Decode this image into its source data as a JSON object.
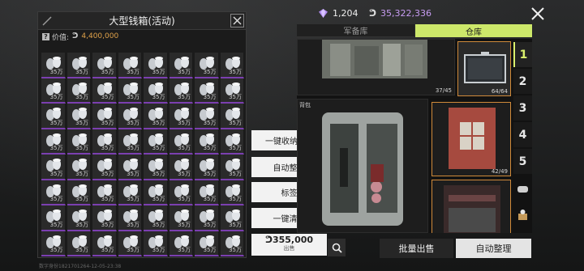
{
  "currency": {
    "gems": "1,204",
    "coins": "35,322,336",
    "gem_color": "#b18bf0",
    "coin_color": "#c79cf2"
  },
  "box_panel": {
    "title": "大型钱箱(活动)",
    "value_label": "价值:",
    "value_amount": "4,400,000",
    "item_label": "35万",
    "rows": 8,
    "cols": 8,
    "item_icon": "silver-cans-icon"
  },
  "actions": {
    "quick_store": "一键收纳",
    "auto_sort": "自动整理",
    "tag": "标签",
    "quick_clear": "一键清空",
    "sale_amount": "355,000",
    "sale_label": "出售"
  },
  "tabs": {
    "reserve": "军备库",
    "warehouse": "仓库"
  },
  "storage": {
    "slot1_count": "37/45",
    "slot2_count": "64/64",
    "backpack_label": "背包",
    "slot3_count": "42/49"
  },
  "side_tabs": [
    "1",
    "2",
    "3",
    "4",
    "5"
  ],
  "bottom": {
    "bulk_sell": "批量出售",
    "auto_sort": "自动整理"
  },
  "watermark": "数字身份1821701264-12-05-23:38",
  "colors": {
    "accent": "#cde86a",
    "rarity_purple": "#7b3fb0",
    "money_orange": "#e0a24a"
  }
}
